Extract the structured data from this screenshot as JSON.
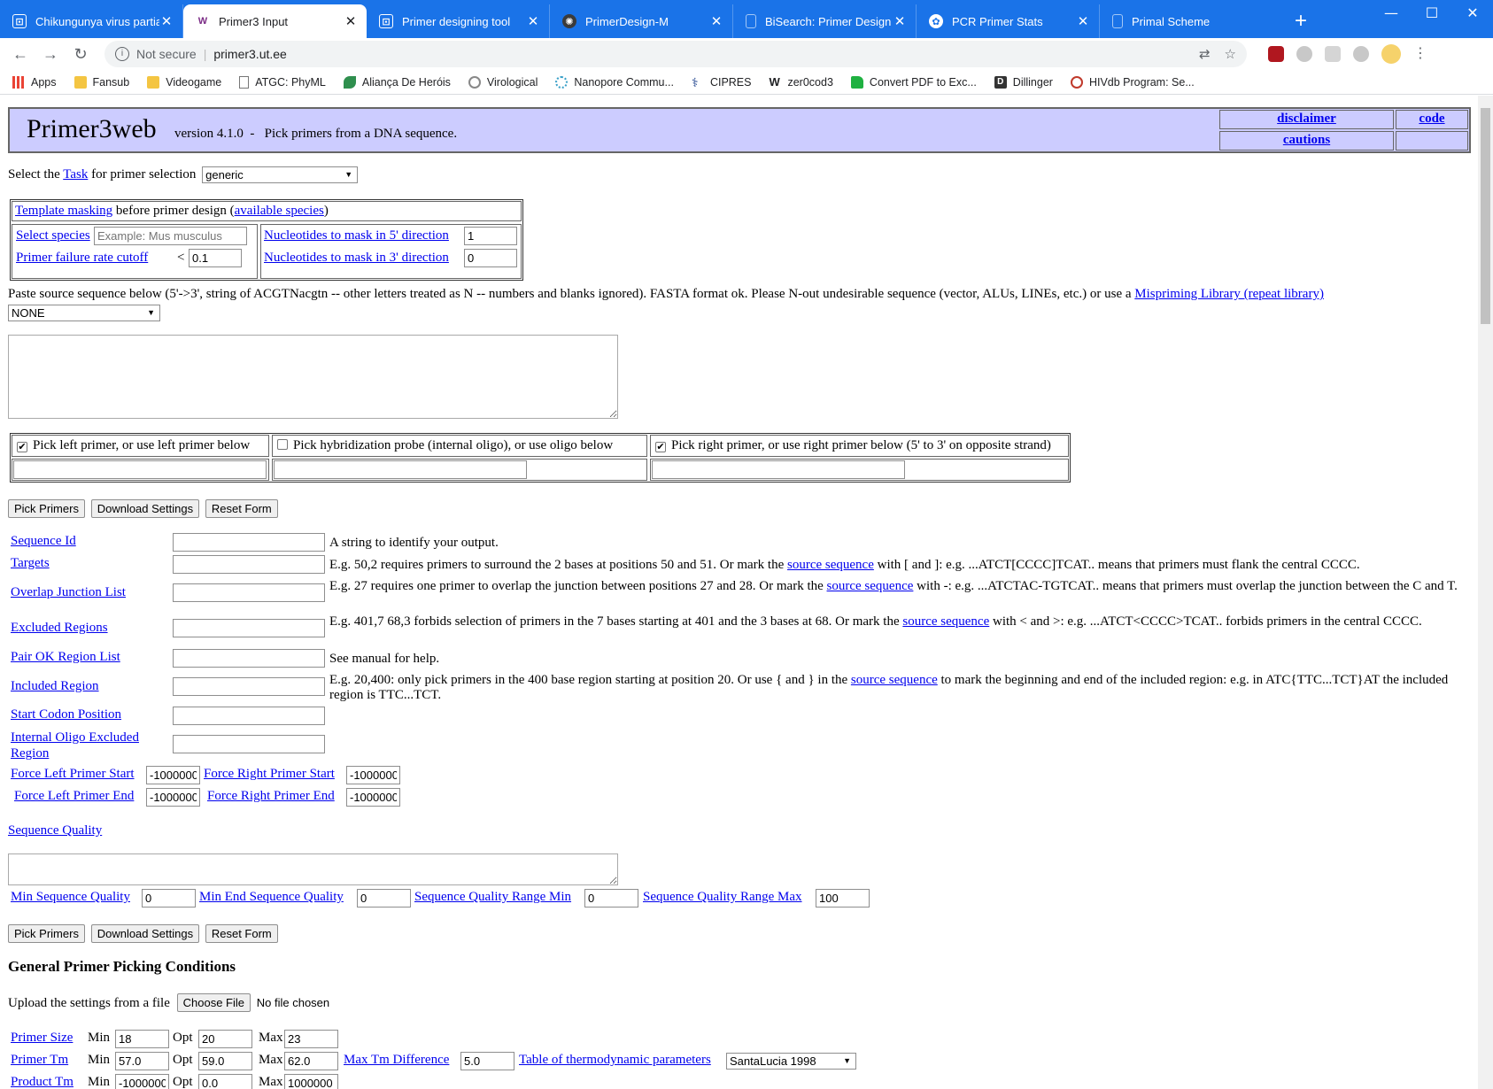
{
  "browser": {
    "tabs": [
      {
        "title": "Chikungunya virus partial v",
        "icon_color": "#ffffff"
      },
      {
        "title": "Primer3 Input",
        "icon_color": "#7b2c86"
      },
      {
        "title": "Primer designing tool",
        "icon_color": "#ffffff"
      },
      {
        "title": "PrimerDesign-M",
        "icon_color": "#ffffff"
      },
      {
        "title": "BiSearch: Primer Design an",
        "icon_color": "#ffffff"
      },
      {
        "title": "PCR Primer Stats",
        "icon_color": "#ffffff"
      },
      {
        "title": "Primal Scheme",
        "icon_color": "#ffffff"
      }
    ],
    "address": {
      "security": "Not secure",
      "url": "primer3.ut.ee"
    },
    "bookmarks": [
      "Apps",
      "Fansub",
      "Videogame",
      "ATGC: PhyML",
      "Aliança De Heróis",
      "Virological",
      "Nanopore Commu...",
      "CIPRES",
      "zer0cod3",
      "Convert PDF to Exc...",
      "Dillinger",
      "HIVdb Program: Se..."
    ]
  },
  "header": {
    "logo": "Primer3web",
    "version_text": "version 4.1.0  -   Pick primers from a DNA sequence.",
    "links": {
      "disclaimer": "disclaimer",
      "code": "code",
      "cautions": "cautions"
    }
  },
  "task": {
    "prefix": "Select the",
    "link": "Task",
    "suffix": "for primer selection",
    "value": "generic"
  },
  "masking": {
    "title_link": "Template masking",
    "title_text": "before primer design (",
    "species_link": "available species",
    "close": ")",
    "select_species": "Select species",
    "species_placeholder": "Example: Mus musculus",
    "failure_rate": "Primer failure rate cutoff",
    "lt": "<",
    "failure_value": "0.1",
    "mask5": "Nucleotides to mask in 5' direction",
    "mask5_value": "1",
    "mask3": "Nucleotides to mask in 3' direction",
    "mask3_value": "0"
  },
  "source": {
    "text": "Paste source sequence below (5'->3', string of ACGTNacgtn -- other letters treated as N -- numbers and blanks ignored). FASTA format ok. Please N-out undesirable sequence (vector, ALUs, LINEs, etc.) or use a",
    "link": "Mispriming Library (repeat library)",
    "library": "NONE"
  },
  "pick": {
    "left": "Pick left primer, or use left primer below",
    "probe": "Pick hybridization probe (internal oligo), or use oligo below",
    "right": "Pick right primer, or use right primer below (5' to 3' on opposite strand)",
    "left_checked": "✔",
    "right_checked": "✔"
  },
  "buttons": {
    "pick": "Pick Primers",
    "download": "Download Settings",
    "reset": "Reset Form"
  },
  "params": [
    {
      "label": "Sequence Id",
      "desc": "A string to identify your output."
    },
    {
      "label": "Targets",
      "desc_pre": "E.g. 50,2 requires primers to surround the 2 bases at positions 50 and 51. Or mark the",
      "link": "source sequence",
      "desc_post": "with [ and ]: e.g. ...ATCT[CCCC]TCAT.. means that primers must flank the central CCCC."
    },
    {
      "label": "Overlap Junction List",
      "desc_pre": "E.g. 27 requires one primer to overlap the junction between positions 27 and 28. Or mark the",
      "link": "source sequence",
      "desc_post": "with -: e.g. ...ATCTAC-TGTCAT.. means that primers must overlap the junction between the C and T."
    },
    {
      "label": "Excluded Regions",
      "desc_pre": "E.g. 401,7 68,3 forbids selection of primers in the 7 bases starting at 401 and the 3 bases at 68. Or mark the",
      "link": "source sequence",
      "desc_post": "with < and >: e.g. ...ATCT<CCCC>TCAT.. forbids primers in the central CCCC."
    },
    {
      "label": "Pair OK Region List",
      "desc": "See manual for help."
    },
    {
      "label": "Included Region",
      "desc_pre": "E.g. 20,400: only pick primers in the 400 base region starting at position 20. Or use { and } in the",
      "link": "source sequence",
      "desc_post": "to mark the beginning and end of the included region: e.g. in ATC{TTC...TCT}AT the included region is TTC...TCT."
    },
    {
      "label": "Start Codon Position"
    },
    {
      "label": "Internal Oligo Excluded Region"
    }
  ],
  "force": {
    "left_start": "Force Left Primer Start",
    "left_start_value": "-1000000",
    "right_start": "Force Right Primer Start",
    "right_start_value": "-1000000",
    "left_end": "Force Left Primer End",
    "left_end_value": "-1000000",
    "right_end": "Force Right Primer End",
    "right_end_value": "-1000000"
  },
  "quality": {
    "title": "Sequence Quality",
    "min": "Min Sequence Quality",
    "min_value": "0",
    "min_end": "Min End Sequence Quality",
    "min_end_value": "0",
    "range_min": "Sequence Quality Range Min",
    "range_min_value": "0",
    "range_max": "Sequence Quality Range Max",
    "range_max_value": "100"
  },
  "general": {
    "heading": "General Primer Picking Conditions",
    "upload": "Upload the settings from a file",
    "choose": "Choose File",
    "no_file": "No file chosen",
    "min": "Min",
    "opt": "Opt",
    "max": "Max",
    "size": {
      "label": "Primer Size",
      "min": "18",
      "opt": "20",
      "max": "23"
    },
    "tm": {
      "label": "Primer Tm",
      "min": "57.0",
      "opt": "59.0",
      "max": "62.0"
    },
    "max_tm_diff": "Max Tm Difference",
    "max_tm_diff_value": "5.0",
    "thermo": "Table of thermodynamic parameters",
    "thermo_value": "SantaLucia 1998",
    "product_tm": {
      "label": "Product Tm",
      "min": "-1000000",
      "opt": "0.0",
      "max": "1000000"
    }
  }
}
